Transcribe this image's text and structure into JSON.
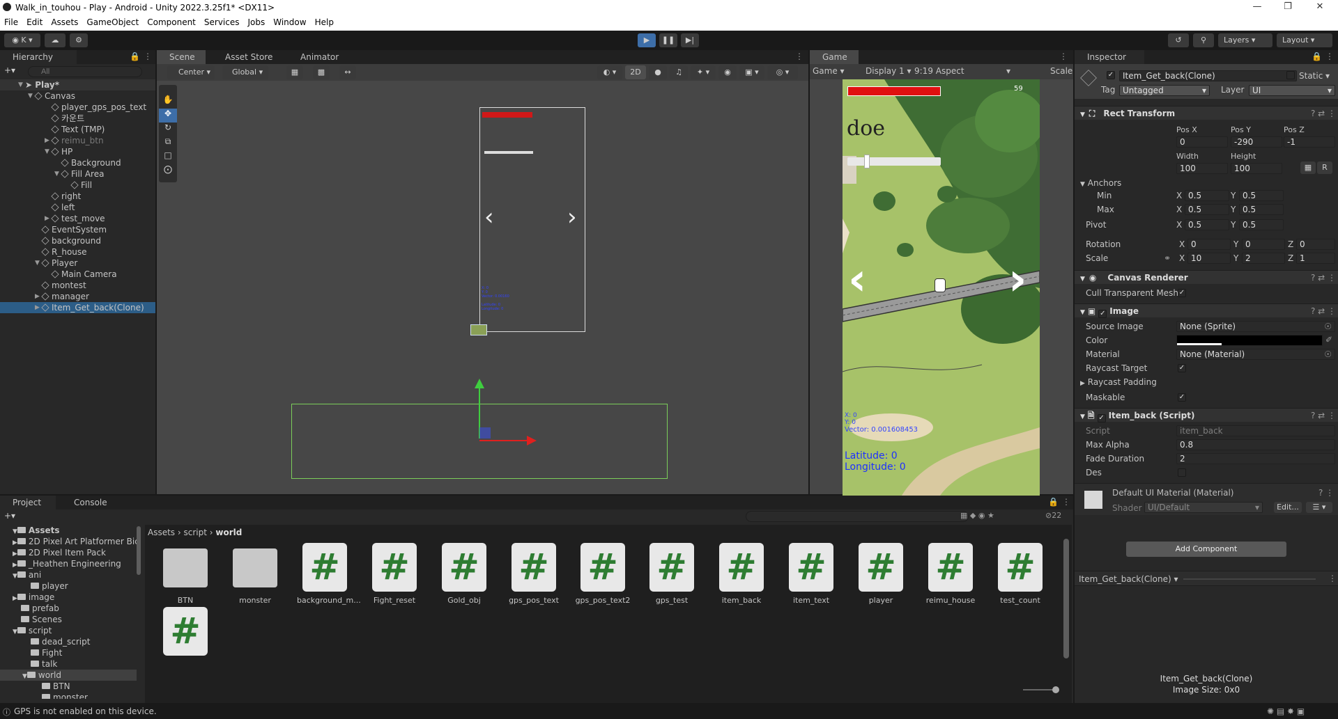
{
  "window": {
    "title": "Walk_in_touhou - Play - Android - Unity 2022.3.25f1* <DX11>"
  },
  "menu": [
    "File",
    "Edit",
    "Assets",
    "GameObject",
    "Component",
    "Services",
    "Jobs",
    "Window",
    "Help"
  ],
  "toolbar": {
    "account": "K",
    "layers": "Layers",
    "layout": "Layout"
  },
  "hierarchy": {
    "tab": "Hierarchy",
    "search_placeholder": "All",
    "scene": "Play*",
    "items": [
      "Canvas",
      "player_gps_pos_text",
      "카운트",
      "Text (TMP)",
      "reimu_btn",
      "HP",
      "Background",
      "Fill Area",
      "Fill",
      "right",
      "left",
      "test_move",
      "EventSystem",
      "background",
      "R_house",
      "Player",
      "Main Camera",
      "montest",
      "manager",
      "Item_Get_back(Clone)"
    ]
  },
  "scene": {
    "tabs": [
      "Scene",
      "Asset Store",
      "Animator"
    ],
    "pivot": "Center",
    "space": "Global",
    "mode2d": "2D"
  },
  "game": {
    "tab": "Game",
    "view": "Game",
    "display": "Display 1",
    "aspect": "9:19 Aspect",
    "scale": "Scale",
    "counter": "59",
    "xy": "X: 0\nY: 0",
    "vector": "Vector: 0.001608453",
    "latitude": "Latitude: 0",
    "longitude": "Longitude: 0"
  },
  "inspector": {
    "tab": "Inspector",
    "object_name": "Item_Get_back(Clone)",
    "static": "Static",
    "tag_label": "Tag",
    "tag": "Untagged",
    "layer_label": "Layer",
    "layer": "UI",
    "rect": {
      "title": "Rect Transform",
      "posx_label": "Pos X",
      "posy_label": "Pos Y",
      "posz_label": "Pos Z",
      "posx": "0",
      "posy": "-290",
      "posz": "-1",
      "width_label": "Width",
      "height_label": "Height",
      "width": "100",
      "height": "100",
      "anchors": "Anchors",
      "min": "Min",
      "max": "Max",
      "min_x": "0.5",
      "min_y": "0.5",
      "max_x": "0.5",
      "max_y": "0.5",
      "pivot": "Pivot",
      "pivot_x": "0.5",
      "pivot_y": "0.5",
      "rotation": "Rotation",
      "rot_x": "0",
      "rot_y": "0",
      "rot_z": "0",
      "scale": "Scale",
      "scale_x": "10",
      "scale_y": "2",
      "scale_z": "1",
      "x": "X",
      "y": "Y",
      "z": "Z",
      "r": "R"
    },
    "canvas_renderer": {
      "title": "Canvas Renderer",
      "cull": "Cull Transparent Mesh"
    },
    "image": {
      "title": "Image",
      "source_label": "Source Image",
      "source": "None (Sprite)",
      "color_label": "Color",
      "material_label": "Material",
      "material": "None (Material)",
      "raycast": "Raycast Target",
      "padding": "Raycast Padding",
      "maskable": "Maskable"
    },
    "script": {
      "title": "Item_back (Script)",
      "script_label": "Script",
      "script": "item_back",
      "max_alpha_label": "Max Alpha",
      "max_alpha": "0.8",
      "fade_label": "Fade Duration",
      "fade": "2",
      "des_label": "Des"
    },
    "material": {
      "title": "Default UI Material (Material)",
      "shader_label": "Shader",
      "shader": "UI/Default",
      "edit": "Edit..."
    },
    "add_component": "Add Component",
    "preview_name": "Item_Get_back(Clone)",
    "preview_title": "Item_Get_back(Clone)",
    "preview_size": "Image Size: 0x0"
  },
  "project": {
    "tabs": [
      "Project",
      "Console"
    ],
    "count": "22",
    "breadcrumb": [
      "Assets",
      "script",
      "world"
    ],
    "tree": [
      "Assets",
      "2D Pixel Art Platformer Bic",
      "2D Pixel Item Pack",
      "_Heathen Engineering",
      "ani",
      "player",
      "image",
      "prefab",
      "Scenes",
      "script",
      "dead_script",
      "Fight",
      "talk",
      "world",
      "BTN",
      "monster"
    ],
    "assets": [
      {
        "name": "BTN",
        "type": "folder"
      },
      {
        "name": "monster",
        "type": "folder"
      },
      {
        "name": "background_m...",
        "type": "script"
      },
      {
        "name": "Fight_reset",
        "type": "script"
      },
      {
        "name": "Gold_obj",
        "type": "script"
      },
      {
        "name": "gps_pos_text",
        "type": "script"
      },
      {
        "name": "gps_pos_text2",
        "type": "script"
      },
      {
        "name": "gps_test",
        "type": "script"
      },
      {
        "name": "item_back",
        "type": "script"
      },
      {
        "name": "item_text",
        "type": "script"
      },
      {
        "name": "player",
        "type": "script"
      },
      {
        "name": "reimu_house",
        "type": "script"
      },
      {
        "name": "test_count",
        "type": "script"
      },
      {
        "name": "",
        "type": "script"
      }
    ]
  },
  "status": {
    "message": "GPS is not enabled on this device."
  }
}
